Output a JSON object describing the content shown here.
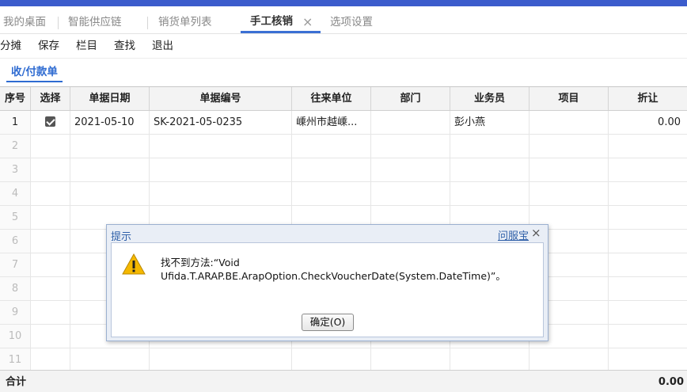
{
  "tabs": [
    {
      "label": "我的桌面"
    },
    {
      "label": "智能供应链"
    },
    {
      "label": "销货单列表"
    },
    {
      "label": "手工核销",
      "active": true,
      "close": "×"
    },
    {
      "label": "选项设置"
    }
  ],
  "toolbar": {
    "split": "分摊",
    "save": "保存",
    "columns": "栏目",
    "find": "查找",
    "exit": "退出"
  },
  "subtab": "收/付款单",
  "table": {
    "headers": [
      "序号",
      "选择",
      "单据日期",
      "单据编号",
      "往来单位",
      "部门",
      "业务员",
      "项目",
      "折让"
    ],
    "rows": [
      {
        "num": "1",
        "checked": true,
        "date": "2021-05-10",
        "code": "SK-2021-05-0235",
        "partner": "嵊州市越嵊...",
        "dept": "",
        "staff": "彭小燕",
        "project": "",
        "discount": "0.00"
      },
      {
        "num": "2"
      },
      {
        "num": "3"
      },
      {
        "num": "4"
      },
      {
        "num": "5"
      },
      {
        "num": "6"
      },
      {
        "num": "7"
      },
      {
        "num": "8"
      },
      {
        "num": "9"
      },
      {
        "num": "10"
      },
      {
        "num": "11"
      }
    ],
    "total_label": "合计",
    "total_value": "0.00"
  },
  "dialog": {
    "title": "提示",
    "help_link": "问服宝",
    "close": "×",
    "icon": "warning-icon",
    "message_line1": "找不到方法:“Void",
    "message_line2": "Ufida.T.ARAP.BE.ArapOption.CheckVoucherDate(System.DateTime)”。",
    "ok_button": "确定(O)"
  },
  "colors": {
    "accent": "#3b6fd4",
    "topbar": "#3b5ccc",
    "dialog_title": "#2e5fa8",
    "warning": "#f5b800"
  }
}
